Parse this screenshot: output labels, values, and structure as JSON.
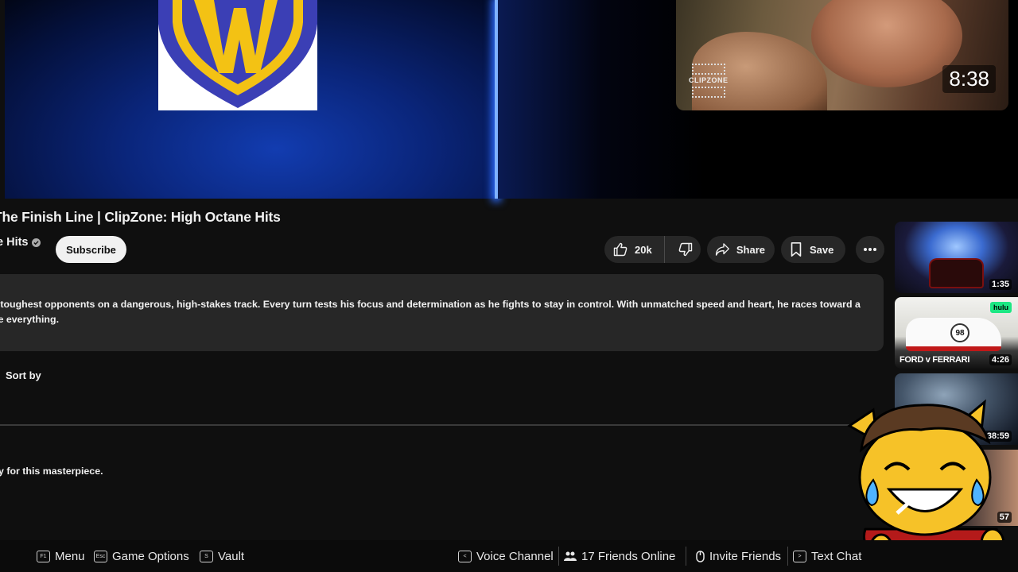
{
  "video": {
    "title": "The Finish Line | ClipZone: High Octane Hits",
    "channel": "e Hits",
    "subscribe_label": "Subscribe",
    "likes": "20k",
    "share_label": "Share",
    "save_label": "Save"
  },
  "mini_player": {
    "duration": "8:38",
    "watermark": "CLIPZONE"
  },
  "description": {
    "line1": "s toughest opponents on a dangerous, high-stakes track. Every turn tests his focus and determination as he fights to stay in control. With unmatched speed and heart, he races toward a",
    "line2": "ne everything."
  },
  "comments": {
    "sort_label": "Sort by",
    "first_comment": "y for this masterpiece."
  },
  "recommendations": [
    {
      "duration": "1:35"
    },
    {
      "duration": "4:26",
      "badge": "hulu",
      "caption": "FORD v FERRARI",
      "number": "98"
    },
    {
      "duration": "38:59"
    },
    {
      "duration": "57"
    }
  ],
  "overlay": {
    "menu": {
      "key": "F1",
      "label": "Menu"
    },
    "game_options": {
      "key": "Esc",
      "label": "Game Options"
    },
    "vault": {
      "key": "S",
      "label": "Vault"
    },
    "voice_channel": {
      "key": "<",
      "label": "Voice Channel"
    },
    "friends_online": "17 Friends Online",
    "invite_friends": "Invite Friends",
    "text_chat": {
      "key": ">",
      "label": "Text Chat"
    }
  },
  "colors": {
    "background": "#0f0f0f",
    "pill": "#272727",
    "text": "#f1f1f1",
    "wb_blue": "#3b3fb5",
    "wb_gold": "#f3c214"
  }
}
